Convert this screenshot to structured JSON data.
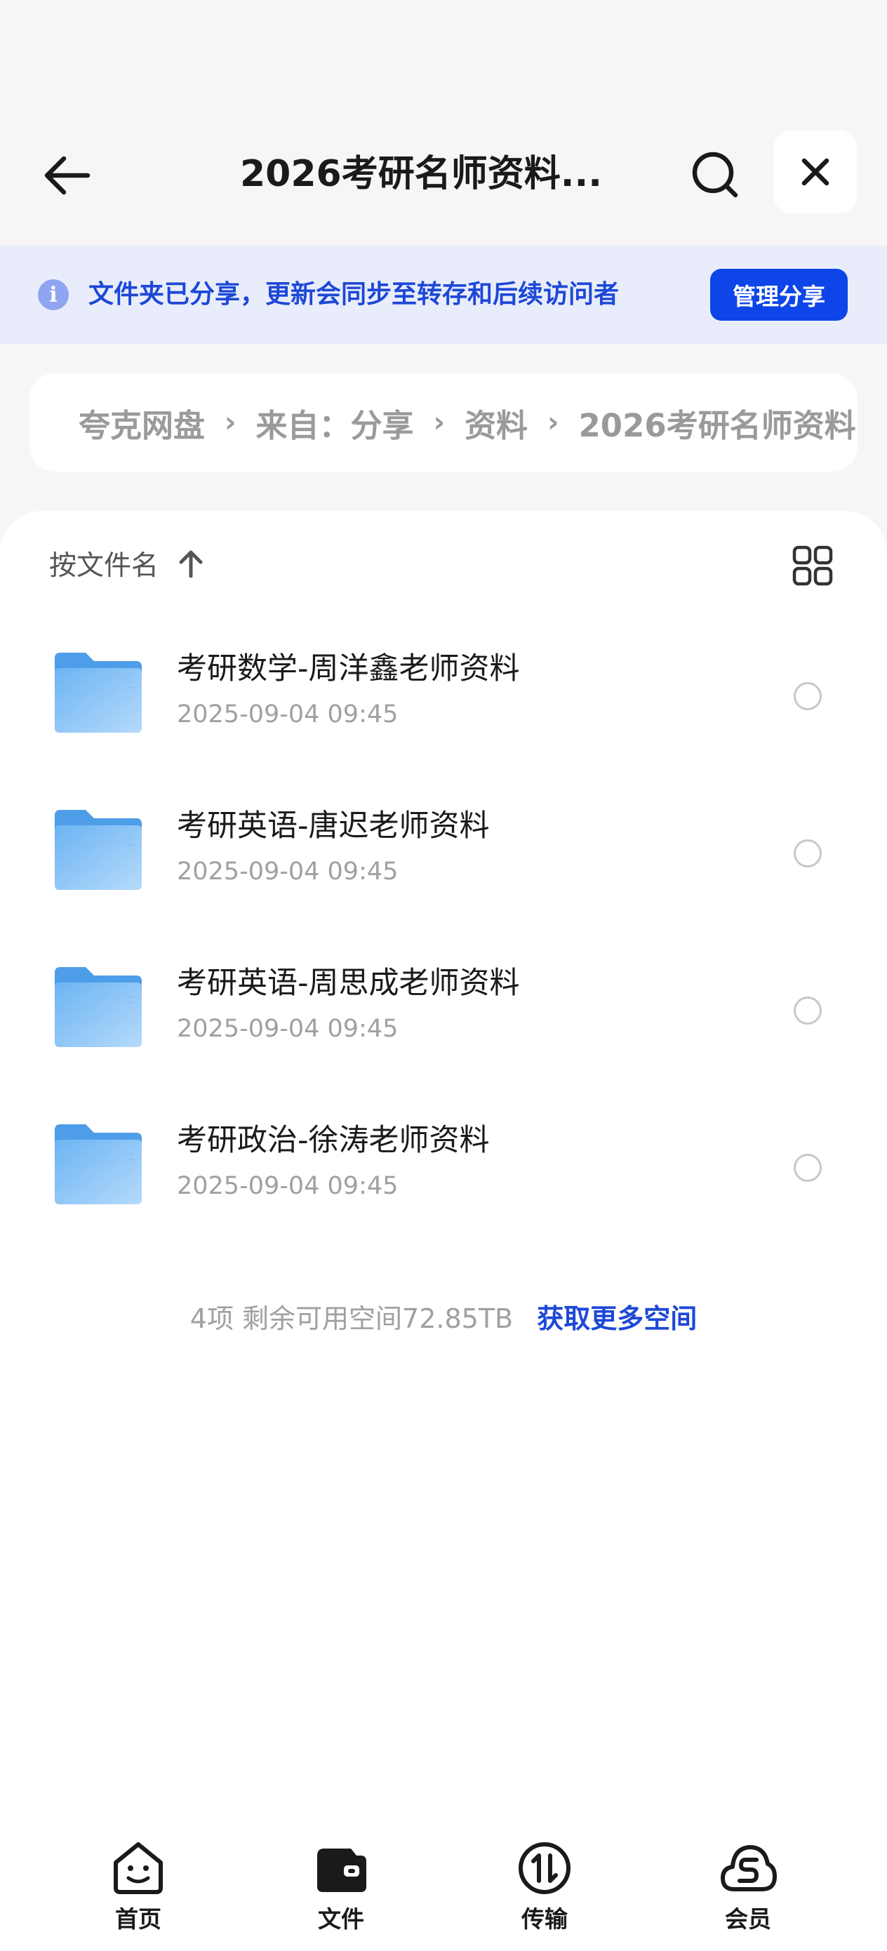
{
  "header": {
    "title": "2026考研名师资料..."
  },
  "banner": {
    "text": "文件夹已分享，更新会同步至转存和后续访问者",
    "button_label": "管理分享"
  },
  "breadcrumb": [
    "夸克网盘",
    "来自：分享",
    "资料",
    "2026考研名师资料"
  ],
  "sort": {
    "label": "按文件名"
  },
  "files": [
    {
      "name": "考研数学-周洋鑫老师资料",
      "date": "2025-09-04 09:45"
    },
    {
      "name": "考研英语-唐迟老师资料",
      "date": "2025-09-04 09:45"
    },
    {
      "name": "考研英语-周思成老师资料",
      "date": "2025-09-04 09:45"
    },
    {
      "name": "考研政治-徐涛老师资料",
      "date": "2025-09-04 09:45"
    }
  ],
  "footer": {
    "count_text": "4项 剩余可用空间72.85TB",
    "link_text": "获取更多空间"
  },
  "tabs": [
    {
      "label": "首页",
      "icon": "home-smile-icon"
    },
    {
      "label": "文件",
      "icon": "wallet-folder-icon"
    },
    {
      "label": "传输",
      "icon": "transfer-icon"
    },
    {
      "label": "会员",
      "icon": "vip-cloud-icon"
    }
  ],
  "colors": {
    "accent": "#0d45e8",
    "banner_bg": "#e9edfb",
    "folder": "#5ba8ee"
  }
}
